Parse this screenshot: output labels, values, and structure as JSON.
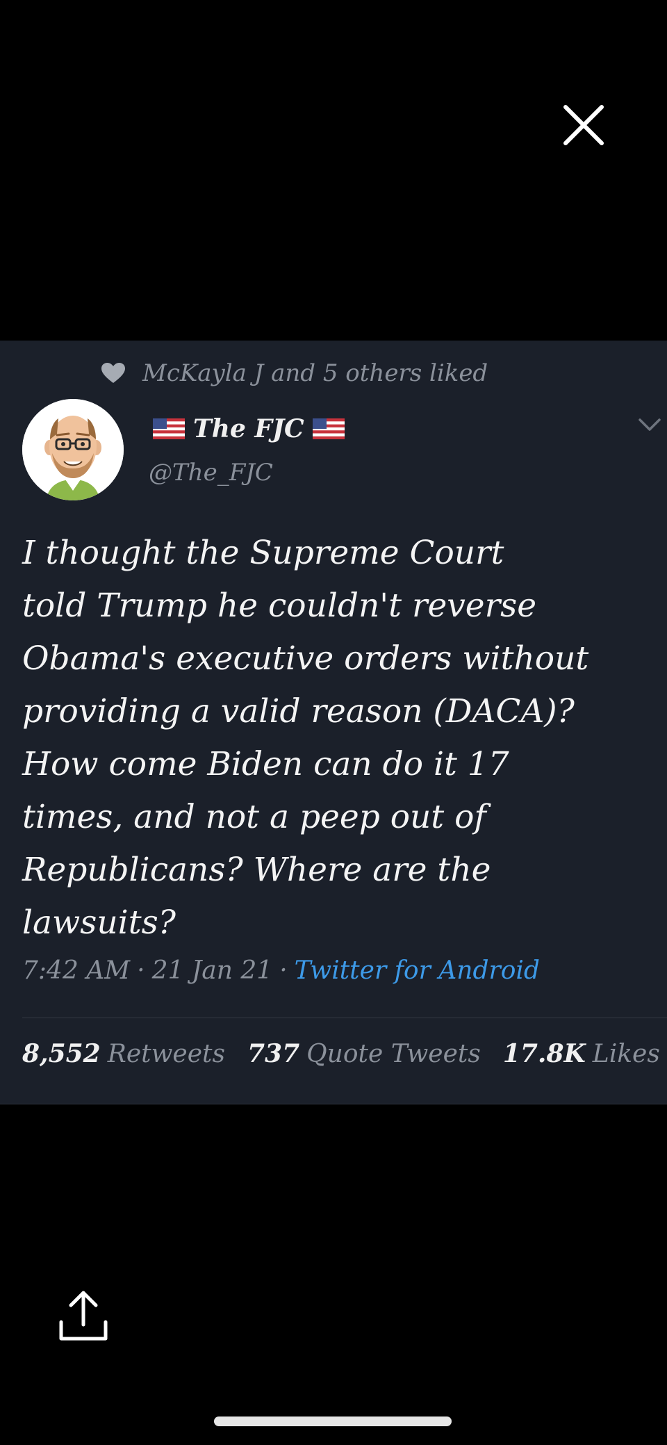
{
  "viewer": {
    "close_icon": "close-icon",
    "share_icon": "share-upload-icon"
  },
  "tweet": {
    "liked_by": "McKayla J and 5 others liked",
    "author": {
      "display_name": "The FJC",
      "name_flag_icon": "us-flag-icon",
      "handle": "@The_FJC",
      "avatar_icon": "cartoon-avatar-icon"
    },
    "text_lines": [
      "I thought the Supreme Court",
      "told Trump he couldn't reverse",
      "Obama's executive orders without",
      "providing a valid reason (DACA)?",
      "How come Biden can do it 17",
      "times, and not a peep out of",
      "Republicans? Where are the",
      "lawsuits?"
    ],
    "time": "7:42 AM",
    "date": "21 Jan 21",
    "separator": "·",
    "source": "Twitter for Android",
    "stats": {
      "retweets_count": "8,552",
      "retweets_label": "Retweets",
      "quotes_count": "737",
      "quotes_label": "Quote Tweets",
      "likes_count": "17.8K",
      "likes_label": "Likes"
    }
  },
  "colors": {
    "page_background": "#000000",
    "card_background": "#1b202a",
    "text_primary": "#f4f4f4",
    "text_secondary": "#8b919b",
    "link": "#3d9ae8"
  }
}
